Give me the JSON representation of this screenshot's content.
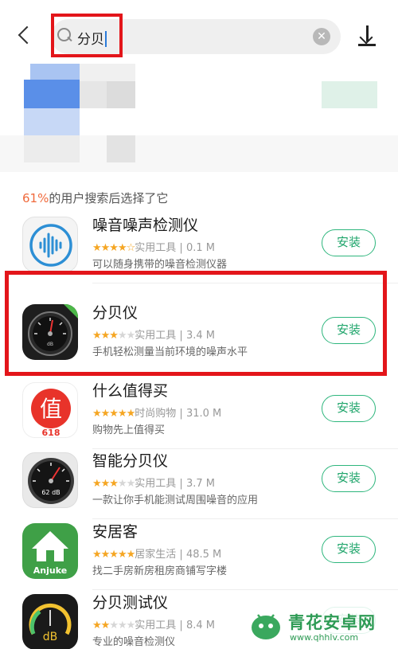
{
  "search": {
    "query": "分贝",
    "clear_symbol": "✕"
  },
  "section": {
    "percent": "61%",
    "title_suffix": "的用户搜索后选择了它"
  },
  "apps": [
    {
      "name": "噪音噪声检测仪",
      "rating": 4.5,
      "stars_text": "★★★★",
      "stars_empty": "☆",
      "category": "实用工具",
      "size": "0.1 M",
      "description": "可以随身携带的噪音检测仪器",
      "install_label": "安装",
      "icon": "sound-wave-icon"
    },
    {
      "name": "分贝仪",
      "rating": 3.5,
      "stars_text": "★★★",
      "stars_empty": "★★",
      "category": "实用工具",
      "size": "3.4 M",
      "description": "手机轻松测量当前环境的噪声水平",
      "install_label": "安装",
      "icon": "decibel-meter-icon"
    },
    {
      "name": "什么值得买",
      "rating": 5,
      "stars_text": "★★★★★",
      "stars_empty": "",
      "category": "时尚购物",
      "size": "31.0 M",
      "description": "购物先上值得买",
      "install_label": "安装",
      "icon": "zhi-618-icon",
      "icon_char": "值",
      "icon_sub": "618"
    },
    {
      "name": "智能分贝仪",
      "rating": 3.5,
      "stars_text": "★★★",
      "stars_empty": "★★",
      "category": "实用工具",
      "size": "3.7 M",
      "description": "一款让你手机能测试周围噪音的应用",
      "install_label": "安装",
      "icon": "gauge-icon",
      "icon_text": "62 dB"
    },
    {
      "name": "安居客",
      "rating": 5,
      "stars_text": "★★★★★",
      "stars_empty": "",
      "category": "居家生活",
      "size": "48.5 M",
      "description": "找二手房新房租房商铺写字楼",
      "install_label": "安装",
      "icon": "anjuke-house-icon",
      "icon_text": "Anjuke"
    },
    {
      "name": "分贝测试仪",
      "rating": 2.5,
      "stars_text": "★★",
      "stars_empty": "★★★",
      "category": "实用工具",
      "size": "8.4 M",
      "description": "专业的噪音检测仪",
      "install_label": "安装",
      "icon": "db-dial-icon",
      "icon_text": "dB"
    }
  ],
  "watermark": {
    "title": "青花安卓网",
    "url": "www.qhhlv.com"
  },
  "colors": {
    "accent_green": "#1fa56b",
    "highlight_red": "#e3151a",
    "percent_orange": "#f06a3c",
    "star_gold": "#f5a623"
  }
}
